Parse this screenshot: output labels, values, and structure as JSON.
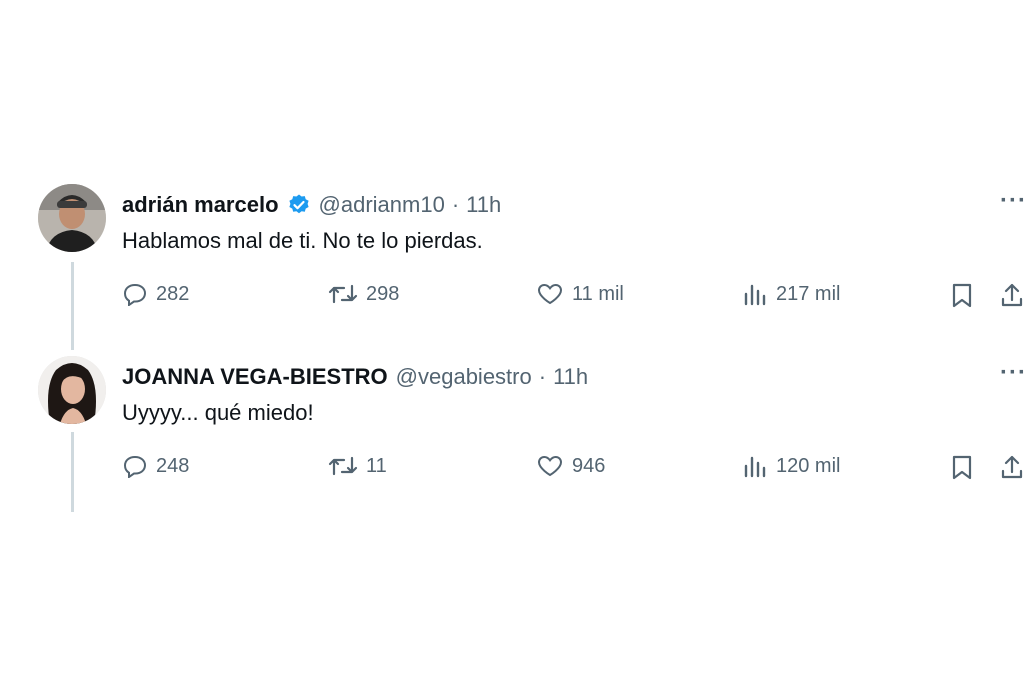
{
  "tweets": [
    {
      "name": "adrián marcelo",
      "verified": true,
      "handle": "@adrianm10",
      "dot": "·",
      "time": "11h",
      "text": "Hablamos mal de ti. No te lo pierdas.",
      "replies": "282",
      "retweets": "298",
      "likes": "11 mil",
      "views": "217 mil"
    },
    {
      "name": "JOANNA VEGA-BIESTRO",
      "verified": false,
      "handle": "@vegabiestro",
      "dot": "·",
      "time": "11h",
      "text": "Uyyyy... qué miedo!",
      "replies": "248",
      "retweets": "11",
      "likes": "946",
      "views": "120 mil"
    }
  ],
  "icons": {
    "reply": "reply-icon",
    "retweet": "retweet-icon",
    "like": "heart-icon",
    "views": "views-icon",
    "bookmark": "bookmark-icon",
    "share": "share-icon",
    "more": "more-icon"
  },
  "colors": {
    "text": "#0f1419",
    "secondary": "#536471",
    "verified": "#1d9bf0",
    "thread_line": "#cfd9de"
  }
}
